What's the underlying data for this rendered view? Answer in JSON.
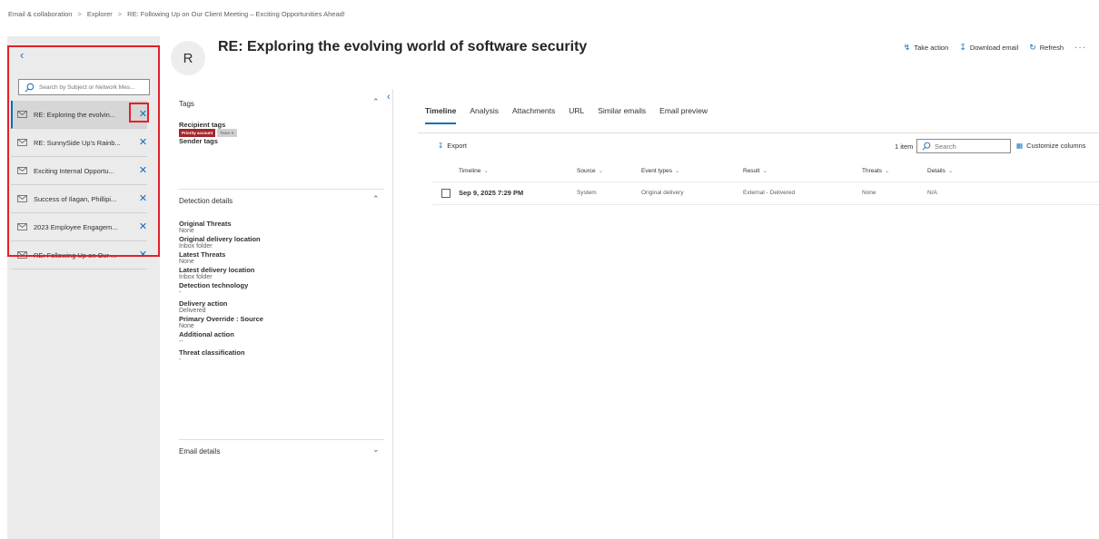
{
  "breadcrumb": [
    "Email & collaboration",
    "Explorer",
    "RE: Following Up on Our Client Meeting – Exciting Opportunities Ahead!"
  ],
  "sidebar": {
    "search_placeholder": "Search by Subject or Network Mes...",
    "items": [
      {
        "label": "RE: Exploring the evolvin..."
      },
      {
        "label": "RE: SunnySide Up's Rainb..."
      },
      {
        "label": "Exciting Internal Opportu..."
      },
      {
        "label": "Success of Ilagan, Phillipi..."
      },
      {
        "label": "2023 Employee Engagem..."
      },
      {
        "label": "RE: Following Up on Our ..."
      }
    ]
  },
  "header": {
    "avatar_initial": "R",
    "title": "RE: Exploring the evolving world of software security",
    "actions": {
      "take_action": "Take action",
      "download": "Download email",
      "refresh": "Refresh"
    }
  },
  "details": {
    "tags_heading": "Tags",
    "recipient_tags_label": "Recipient tags",
    "recipient_tags": [
      "Priority account",
      "Team X"
    ],
    "sender_tags_label": "Sender tags",
    "detection_heading": "Detection details",
    "fields": [
      {
        "key": "Original Threats",
        "value": "None"
      },
      {
        "key": "Original delivery location",
        "value": "Inbox folder"
      },
      {
        "key": "Latest Threats",
        "value": "None"
      },
      {
        "key": "Latest delivery location",
        "value": "Inbox folder"
      },
      {
        "key": "Detection technology",
        "value": "-"
      },
      {
        "key": "Delivery action",
        "value": "Delivered"
      },
      {
        "key": "Primary Override : Source",
        "value": "None"
      },
      {
        "key": "Additional action",
        "value": "--"
      },
      {
        "key": "Threat classification",
        "value": "-"
      }
    ],
    "email_details_heading": "Email details"
  },
  "tabs": [
    "Timeline",
    "Analysis",
    "Attachments",
    "URL",
    "Similar emails",
    "Email preview"
  ],
  "toolbar": {
    "export": "Export",
    "item_count": "1 item",
    "search_placeholder": "Search",
    "customize": "Customize columns"
  },
  "table": {
    "columns": [
      "Timeline",
      "Source",
      "Event types",
      "Result",
      "Threats",
      "Details"
    ],
    "rows": [
      {
        "timeline": "Sep 9, 2025 7:29 PM",
        "source": "System",
        "event": "Original delivery",
        "result": "External - Delivered",
        "threats": "None",
        "details": "N/A"
      }
    ]
  },
  "colors": {
    "accent": "#0f6cbd",
    "highlight": "#e3202b",
    "badge": "#a4262c"
  }
}
